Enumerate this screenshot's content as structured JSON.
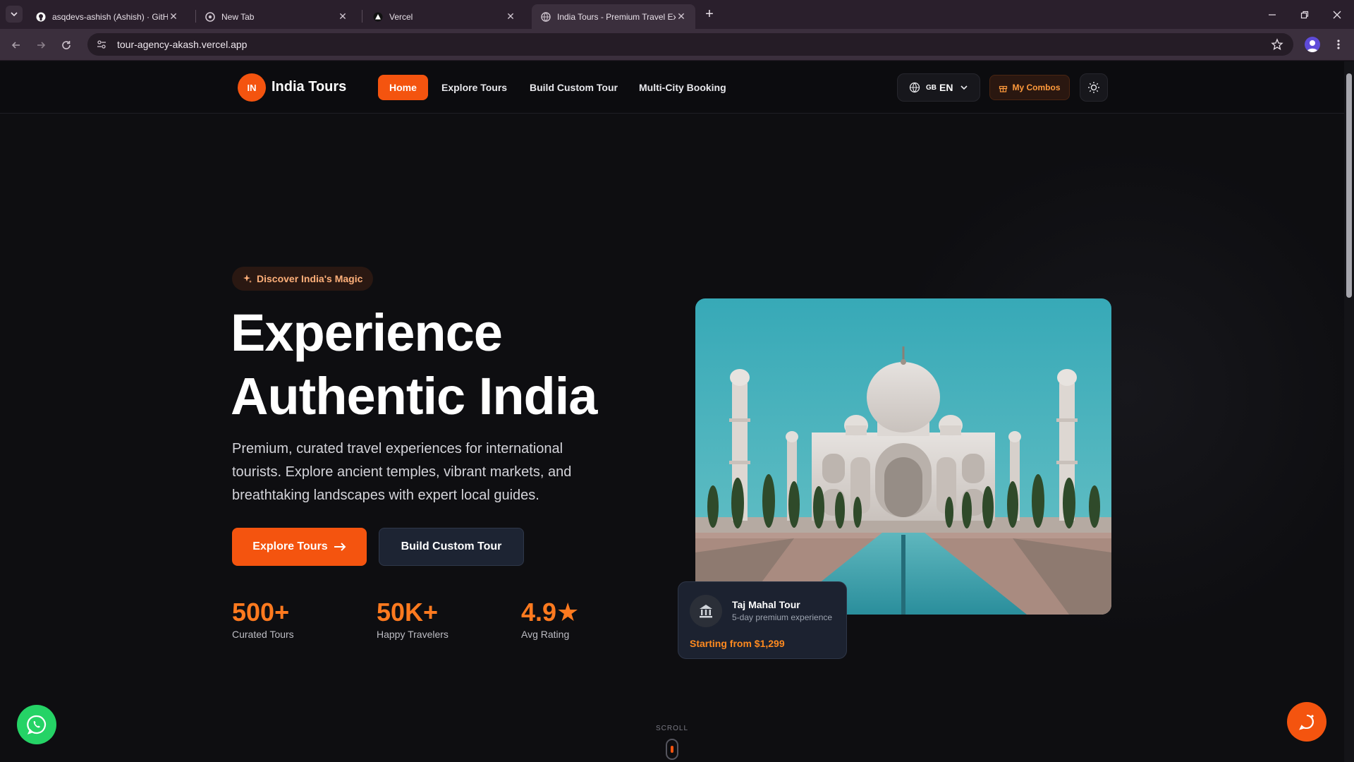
{
  "browser": {
    "tabs": [
      {
        "title": "asqdevs-ashish (Ashish) · GitHub",
        "icon": "github-icon"
      },
      {
        "title": "New Tab",
        "icon": "chrome-icon"
      },
      {
        "title": "Vercel",
        "icon": "vercel-icon"
      },
      {
        "title": "India Tours - Premium Travel Experiences",
        "icon": "globe-icon",
        "active": true
      }
    ],
    "url": "tour-agency-akash.vercel.app"
  },
  "site": {
    "logo_badge": "IN",
    "logo_text": "India Tours",
    "nav": [
      "Home",
      "Explore Tours",
      "Build Custom Tour",
      "Multi-City Booking"
    ],
    "lang_flag": "GB",
    "lang_code": "EN",
    "combos_label": "My Combos",
    "colors": {
      "accent": "#f4540f",
      "stat": "#ff7a1f",
      "whatsapp": "#25d366"
    }
  },
  "hero": {
    "pill": "Discover India's Magic",
    "title_line1": "Experience",
    "title_line2": "Authentic India",
    "description": "Premium, curated travel experiences for international tourists. Explore ancient temples, vibrant markets, and breathtaking landscapes with expert local guides.",
    "primary_cta": "Explore Tours",
    "secondary_cta": "Build Custom Tour",
    "stats": [
      {
        "value": "500+",
        "label": "Curated Tours"
      },
      {
        "value": "50K+",
        "label": "Happy Travelers"
      },
      {
        "value": "4.9★",
        "label": "Avg Rating"
      }
    ]
  },
  "tour_card": {
    "title": "Taj Mahal Tour",
    "subtitle": "5-day premium experience",
    "price": "Starting from $1,299"
  },
  "scroll_label": "SCROLL"
}
